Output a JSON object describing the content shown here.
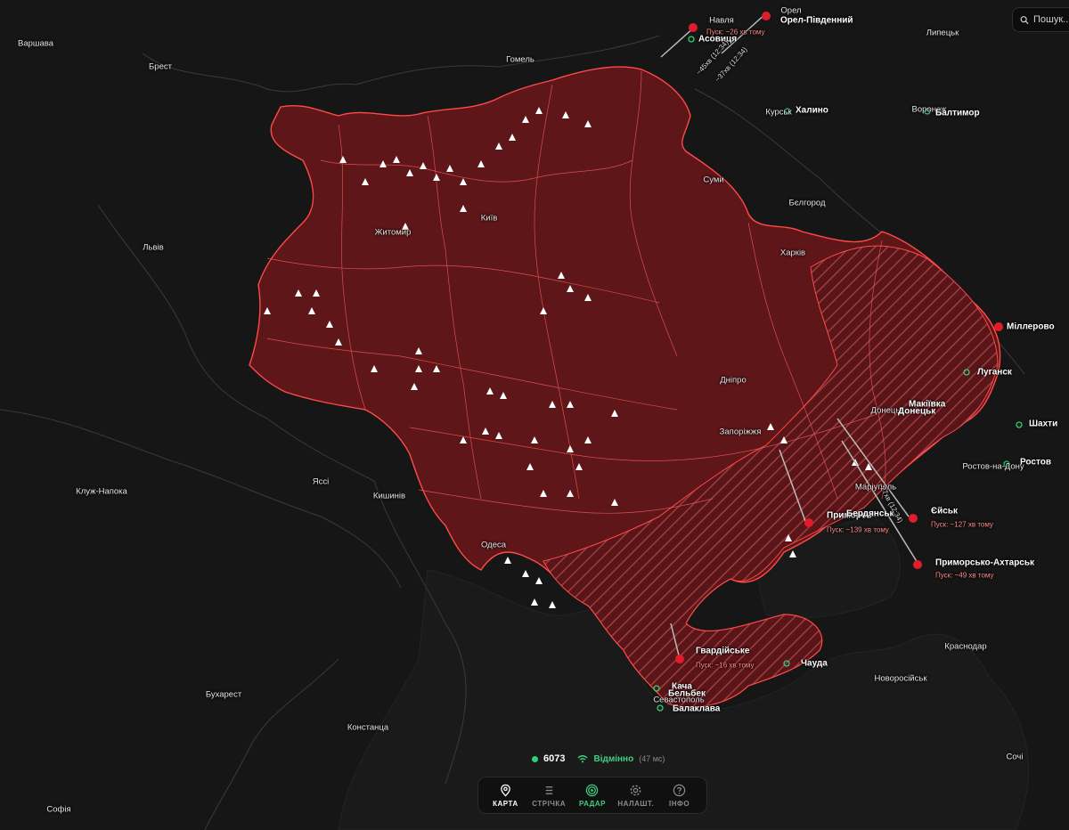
{
  "search": {
    "placeholder": "Пошук..."
  },
  "status": {
    "count": "6073",
    "connection": "Відмінно",
    "latency": "(47 мс)"
  },
  "nav": [
    {
      "label": "КАРТА",
      "icon": "map-pin-icon"
    },
    {
      "label": "СТРІЧКА",
      "icon": "list-icon"
    },
    {
      "label": "РАДАР",
      "icon": "radar-icon"
    },
    {
      "label": "НАЛАШТ.",
      "icon": "gear-icon"
    },
    {
      "label": "ІНФО",
      "icon": "help-icon"
    }
  ],
  "colors": {
    "alert": "#b1252b",
    "border": "#ff4a4a",
    "ok": "#3ecf82",
    "background": "#161616"
  },
  "map": {
    "cities": {
      "warsaw": "Варшава",
      "brest": "Брест",
      "gomel": "Гомель",
      "lipetsk": "Липецьк",
      "kursk": "Курськ",
      "voronezh": "Воронеж",
      "belgorod": "Бєлгород",
      "lviv": "Львів",
      "zhytomyr": "Житомир",
      "kyiv": "Київ",
      "sumy": "Суми",
      "kharkiv": "Харків",
      "dnipro": "Дніпро",
      "zaporizhzhia": "Запоріжжя",
      "donetsk": "Донецьк",
      "mariupol": "Маріуполь",
      "rostov": "Ростов-на-Дону",
      "cluj": "Клуж-Напока",
      "iasi": "Яссі",
      "chisinau": "Кишинів",
      "odesa": "Одеса",
      "bucharest": "Бухарест",
      "constanta": "Констанца",
      "sofia": "Софія",
      "krasnodar": "Краснодар",
      "novorossiysk": "Новоросійськ",
      "sochi": "Сочі",
      "sevastopol": "Севастополь",
      "orel": "Орел"
    },
    "launch_sites": {
      "navlya": "Навля",
      "asovytsia": "Асовиця",
      "orel_south": "Орел-Південний",
      "khalino": "Халино",
      "baltimor": "Балтимор",
      "millerovo": "Міллерово",
      "luhansk": "Луганск",
      "makiivka": "Макіївка",
      "donetsk2": "Донецьк",
      "shakhty": "Шахти",
      "rostov2": "Ростов",
      "yeysk": "Єйськ",
      "prymorsko": "Приморсько-Ахтарськ",
      "prymorske": "Приморсь",
      "berdiansk": "Бердянськ",
      "hvardiiske": "Гвардійське",
      "chauda": "Чауда",
      "kacha": "Кача",
      "belbek": "Бельбек",
      "balaklava": "Балаклава"
    },
    "launch_times": {
      "asovytsia": "Пуск: ~26 хв тому",
      "yeysk": "Пуск: ~127 хв тому",
      "prymorsko": "Пуск: ~49 хв тому",
      "prymorske": "Пуск: ~139 хв тому",
      "hvardiiske": "Пуск: ~16 хв тому"
    },
    "tracks": {
      "north1": "~45хв (12:34)",
      "north2": "~37хв (12:34)",
      "south": "~27хв (12:34)"
    }
  }
}
